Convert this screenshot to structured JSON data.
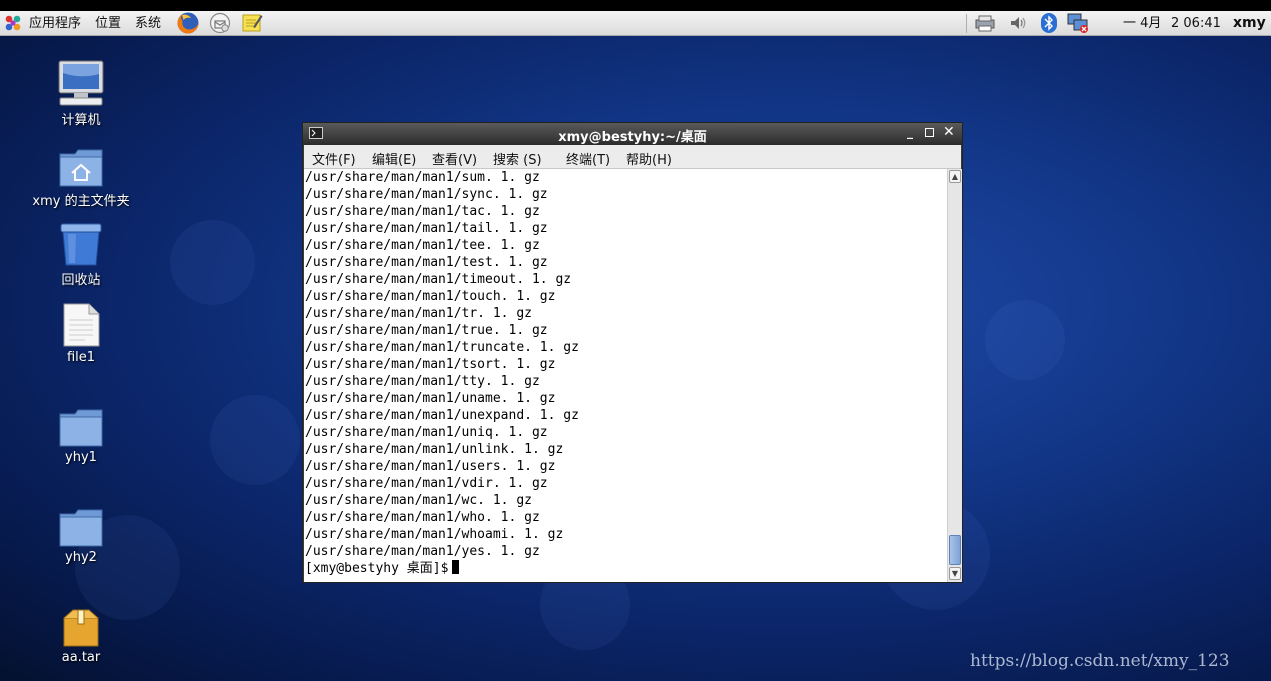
{
  "panel": {
    "menus": {
      "applications": "应用程序",
      "places": "位置",
      "system": "系统"
    },
    "clock": {
      "day": "一 4月",
      "time": "2 06:41"
    },
    "user": "xmy"
  },
  "desktop": {
    "icons": [
      {
        "label": "计算机",
        "icon": "computer-icon"
      },
      {
        "label": "xmy 的主文件夹",
        "icon": "home-folder-icon"
      },
      {
        "label": "回收站",
        "icon": "trash-icon"
      },
      {
        "label": "file1",
        "icon": "text-file-icon"
      },
      {
        "label": "yhy1",
        "icon": "folder-icon"
      },
      {
        "label": "yhy2",
        "icon": "folder-icon"
      },
      {
        "label": "aa.tar",
        "icon": "archive-icon"
      }
    ]
  },
  "terminal": {
    "title": "xmy@bestyhy:~/桌面",
    "menu": [
      "文件(F)",
      "编辑(E)",
      "查看(V)",
      "搜索 (S)",
      "终端(T)",
      "帮助(H)"
    ],
    "lines": [
      "/usr/share/man/man1/sum. 1. gz",
      "/usr/share/man/man1/sync. 1. gz",
      "/usr/share/man/man1/tac. 1. gz",
      "/usr/share/man/man1/tail. 1. gz",
      "/usr/share/man/man1/tee. 1. gz",
      "/usr/share/man/man1/test. 1. gz",
      "/usr/share/man/man1/timeout. 1. gz",
      "/usr/share/man/man1/touch. 1. gz",
      "/usr/share/man/man1/tr. 1. gz",
      "/usr/share/man/man1/true. 1. gz",
      "/usr/share/man/man1/truncate. 1. gz",
      "/usr/share/man/man1/tsort. 1. gz",
      "/usr/share/man/man1/tty. 1. gz",
      "/usr/share/man/man1/uname. 1. gz",
      "/usr/share/man/man1/unexpand. 1. gz",
      "/usr/share/man/man1/uniq. 1. gz",
      "/usr/share/man/man1/unlink. 1. gz",
      "/usr/share/man/man1/users. 1. gz",
      "/usr/share/man/man1/vdir. 1. gz",
      "/usr/share/man/man1/wc. 1. gz",
      "/usr/share/man/man1/who. 1. gz",
      "/usr/share/man/man1/whoami. 1. gz",
      "/usr/share/man/man1/yes. 1. gz"
    ],
    "prompt": "[xmy@bestyhy 桌面]$"
  },
  "watermark": "https://blog.csdn.net/xmy_123"
}
